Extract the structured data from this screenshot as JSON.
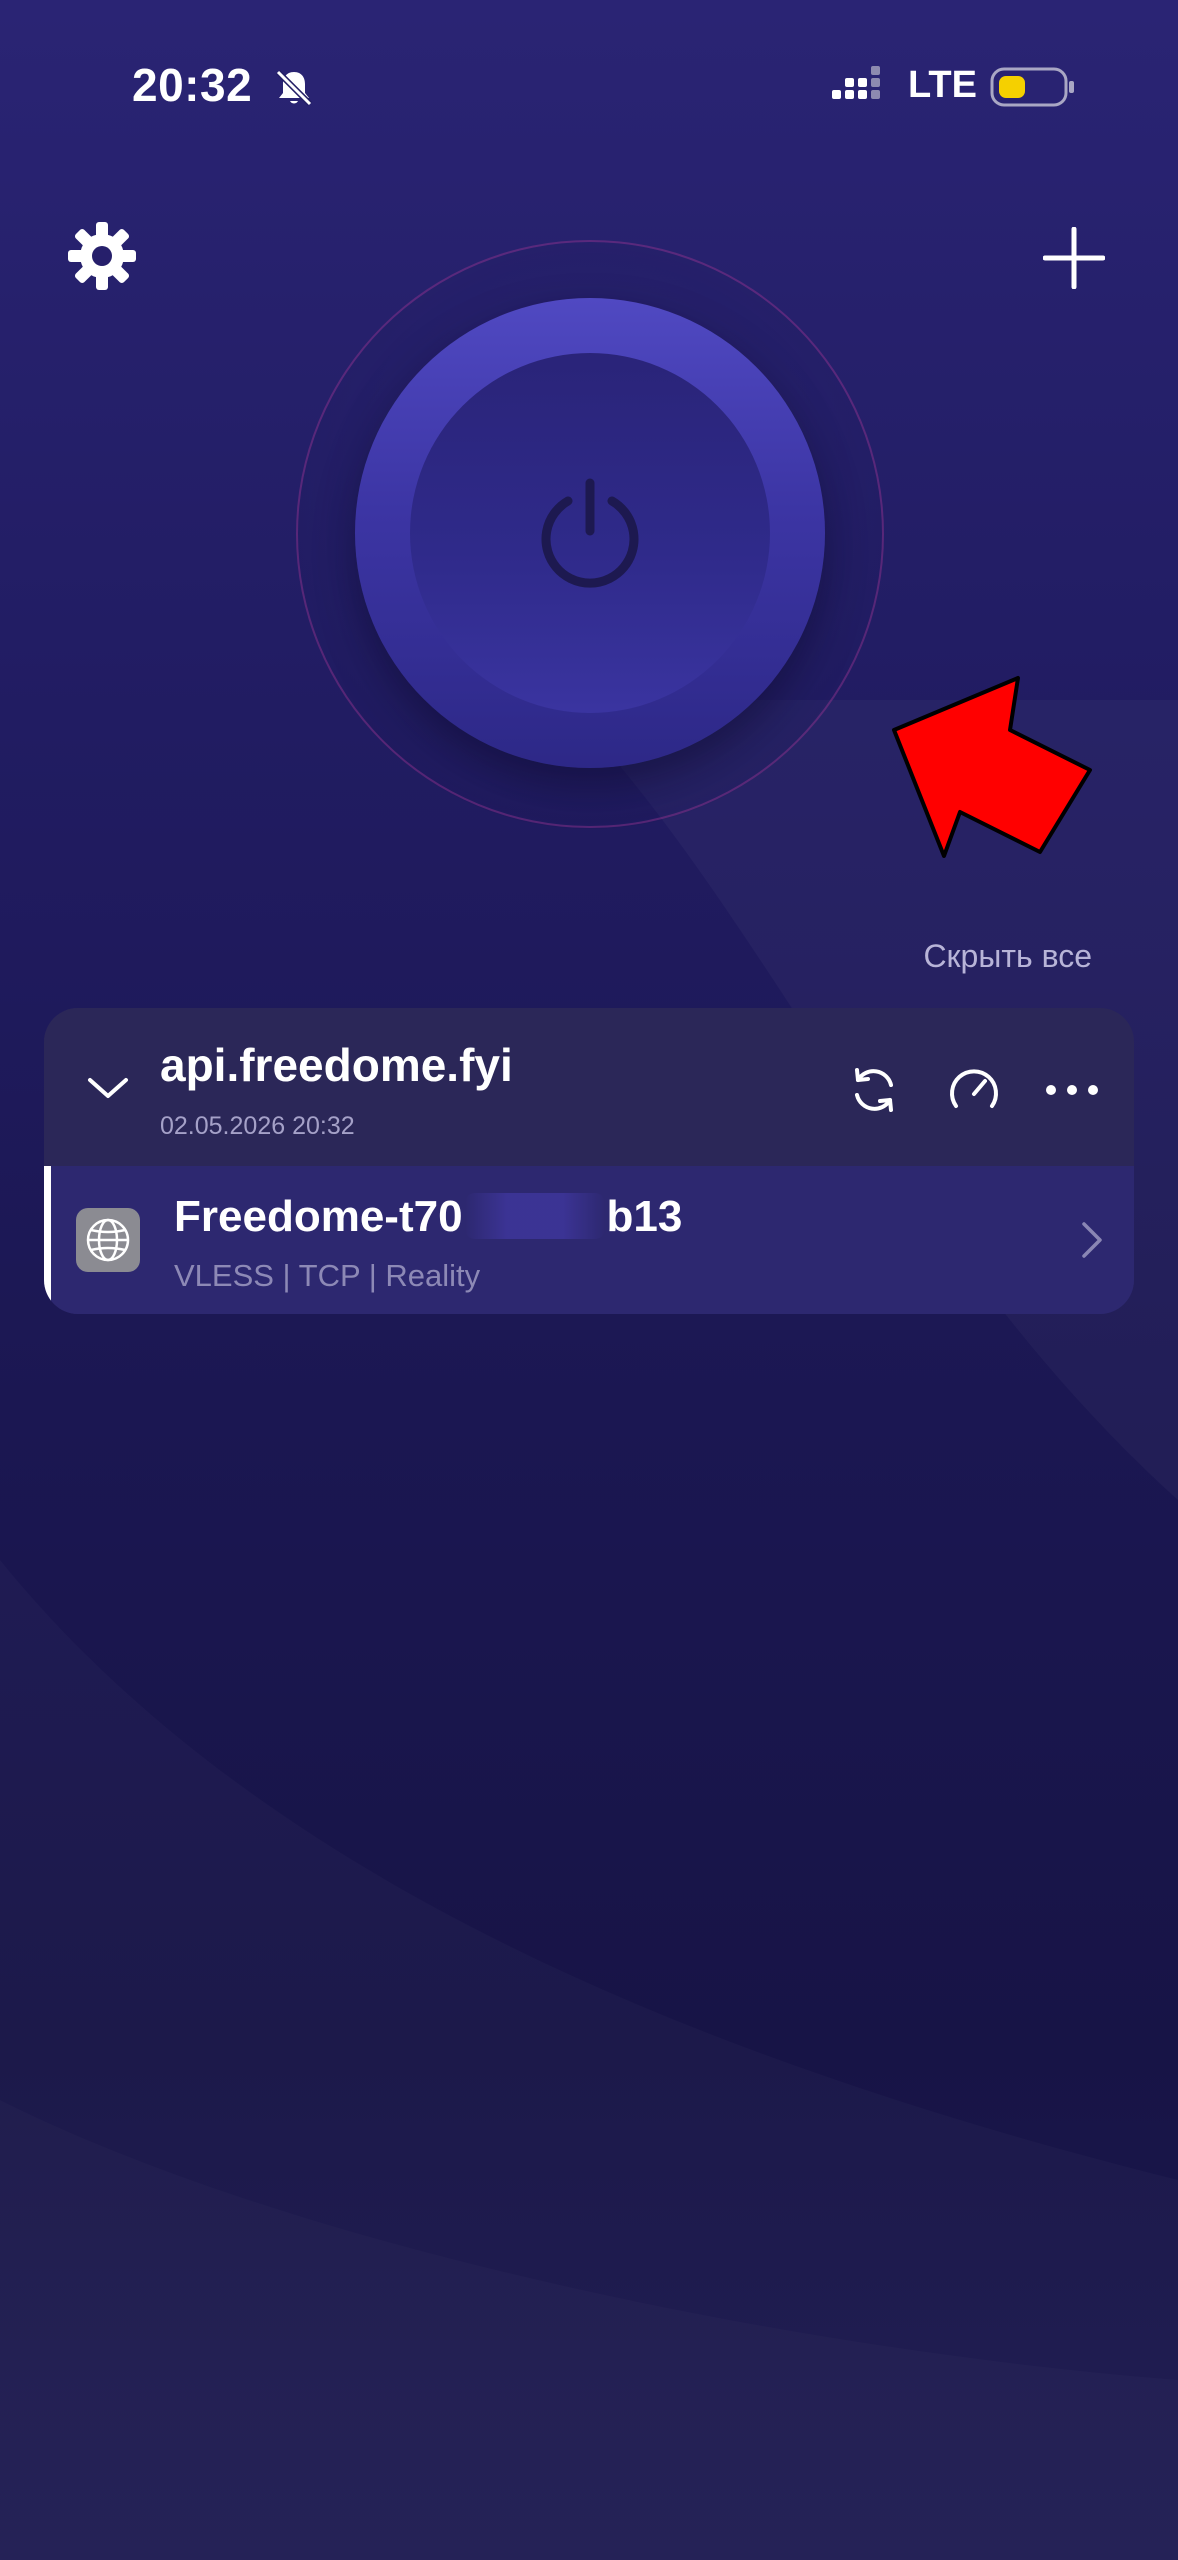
{
  "status_bar": {
    "time": "20:32",
    "network": "LTE",
    "icons": [
      "bell-mute-icon",
      "signal-icon",
      "battery-icon"
    ],
    "battery_color": "#f5d000"
  },
  "toolbar": {
    "settings_icon": "gear-icon",
    "add_icon": "plus-icon"
  },
  "power": {
    "icon": "power-icon",
    "state": "disconnected"
  },
  "list": {
    "hide_all_label": "Скрыть все"
  },
  "subscription": {
    "title": "api.freedome.fyi",
    "updated": "02.05.2026 20:32",
    "actions": [
      "refresh-icon",
      "speedometer-icon",
      "more-icon"
    ],
    "servers": [
      {
        "name_prefix": "Freedome-t70",
        "name_suffix": "b13",
        "protocol": "VLESS | TCP | Reality",
        "icon": "globe-icon",
        "selected": true
      }
    ]
  },
  "colors": {
    "background": "#211c62",
    "accent": "#4d46bf",
    "annotation_arrow": "#ff0000"
  }
}
